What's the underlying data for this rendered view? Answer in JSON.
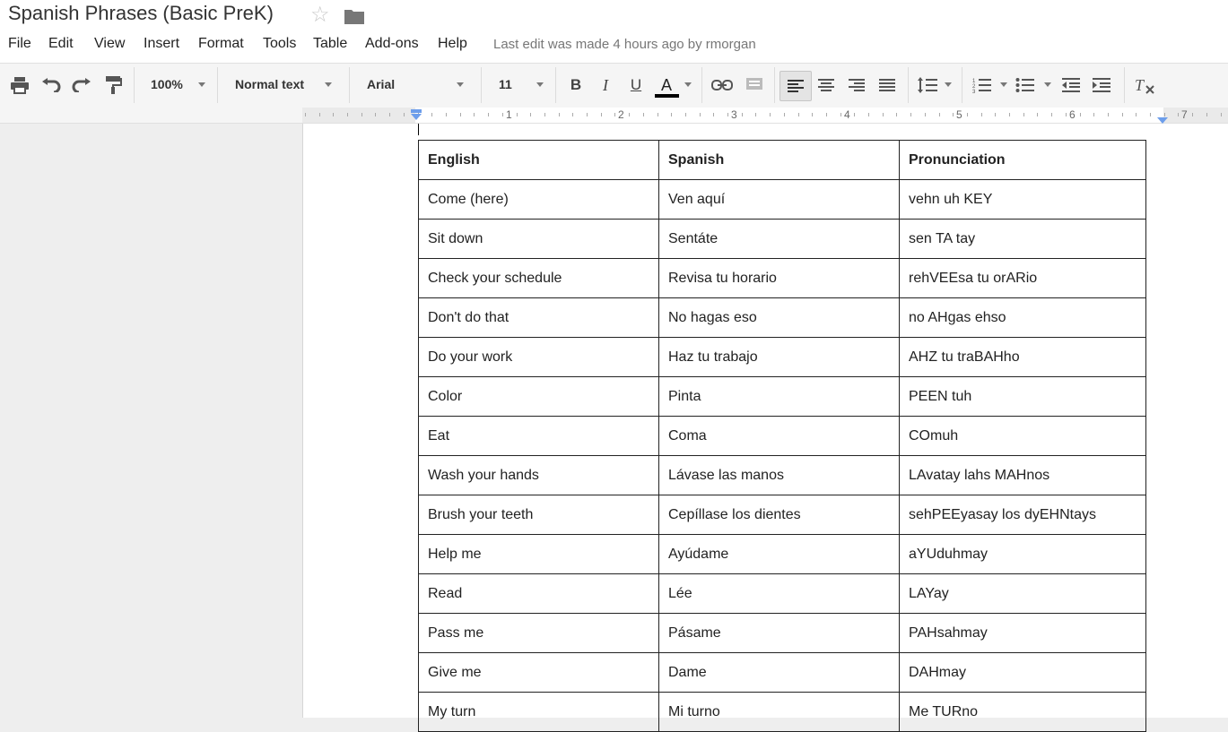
{
  "document": {
    "title": "Spanish Phrases (Basic PreK)",
    "last_edit": "Last edit was made 4 hours ago by rmorgan"
  },
  "menu": [
    "File",
    "Edit",
    "View",
    "Insert",
    "Format",
    "Tools",
    "Table",
    "Add-ons",
    "Help"
  ],
  "toolbar": {
    "zoom": "100%",
    "style": "Normal text",
    "font": "Arial",
    "font_size": "11",
    "bold_glyph": "B",
    "italic_glyph": "I",
    "underline_glyph": "U",
    "text_color_glyph": "A",
    "text_color": "#000000",
    "active_alignment": "align-left"
  },
  "ruler": {
    "numbers": [
      "1",
      "2",
      "3",
      "4",
      "5",
      "6",
      "7"
    ]
  },
  "table": {
    "headers": [
      "English",
      "Spanish",
      "Pronunciation"
    ],
    "rows": [
      [
        "Come (here)",
        "Ven aquí",
        "vehn uh KEY"
      ],
      [
        "Sit down",
        "Sentáte",
        "sen TA tay"
      ],
      [
        "Check your schedule",
        "Revisa tu horario",
        "rehVEEsa tu orARio"
      ],
      [
        "Don't do that",
        "No hagas eso",
        "no AHgas ehso"
      ],
      [
        "Do your work",
        "Haz tu trabajo",
        "AHZ tu traBAHho"
      ],
      [
        "Color",
        "Pinta",
        "PEEN tuh"
      ],
      [
        "Eat",
        "Coma",
        "COmuh"
      ],
      [
        "Wash your hands",
        "Lávase las manos",
        "LAvatay lahs MAHnos"
      ],
      [
        "Brush your teeth",
        "Cepíllase los dientes",
        "sehPEEyasay los dyEHNtays"
      ],
      [
        "Help me",
        "Ayúdame",
        "aYUduhmay"
      ],
      [
        "Read",
        "Lée",
        "LAYay"
      ],
      [
        "Pass me",
        "Pásame",
        "PAHsahmay"
      ],
      [
        "Give me",
        "Dame",
        "DAHmay"
      ],
      [
        "My turn",
        "Mi turno",
        "Me TURno"
      ]
    ]
  }
}
